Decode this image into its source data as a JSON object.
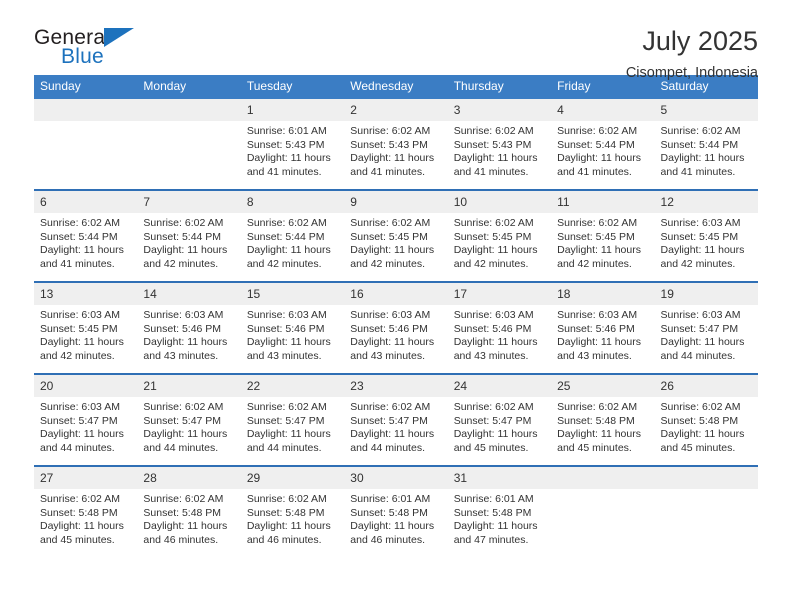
{
  "brand": {
    "name_part1": "General",
    "name_part2": "Blue"
  },
  "header": {
    "title": "July 2025",
    "subtitle": "Cisompet, Indonesia"
  },
  "colors": {
    "header_blue": "#3b7dc4",
    "divider_blue": "#2f6fb5",
    "daynum_band": "#efefef",
    "logo_blue": "#1d72bd",
    "text": "#333333"
  },
  "weekday_headers": [
    "Sunday",
    "Monday",
    "Tuesday",
    "Wednesday",
    "Thursday",
    "Friday",
    "Saturday"
  ],
  "weeks": [
    [
      {
        "day": "",
        "sunrise": "",
        "sunset": "",
        "daylight_line1": "",
        "daylight_line2": ""
      },
      {
        "day": "",
        "sunrise": "",
        "sunset": "",
        "daylight_line1": "",
        "daylight_line2": ""
      },
      {
        "day": "1",
        "sunrise": "Sunrise: 6:01 AM",
        "sunset": "Sunset: 5:43 PM",
        "daylight_line1": "Daylight: 11 hours",
        "daylight_line2": "and 41 minutes."
      },
      {
        "day": "2",
        "sunrise": "Sunrise: 6:02 AM",
        "sunset": "Sunset: 5:43 PM",
        "daylight_line1": "Daylight: 11 hours",
        "daylight_line2": "and 41 minutes."
      },
      {
        "day": "3",
        "sunrise": "Sunrise: 6:02 AM",
        "sunset": "Sunset: 5:43 PM",
        "daylight_line1": "Daylight: 11 hours",
        "daylight_line2": "and 41 minutes."
      },
      {
        "day": "4",
        "sunrise": "Sunrise: 6:02 AM",
        "sunset": "Sunset: 5:44 PM",
        "daylight_line1": "Daylight: 11 hours",
        "daylight_line2": "and 41 minutes."
      },
      {
        "day": "5",
        "sunrise": "Sunrise: 6:02 AM",
        "sunset": "Sunset: 5:44 PM",
        "daylight_line1": "Daylight: 11 hours",
        "daylight_line2": "and 41 minutes."
      }
    ],
    [
      {
        "day": "6",
        "sunrise": "Sunrise: 6:02 AM",
        "sunset": "Sunset: 5:44 PM",
        "daylight_line1": "Daylight: 11 hours",
        "daylight_line2": "and 41 minutes."
      },
      {
        "day": "7",
        "sunrise": "Sunrise: 6:02 AM",
        "sunset": "Sunset: 5:44 PM",
        "daylight_line1": "Daylight: 11 hours",
        "daylight_line2": "and 42 minutes."
      },
      {
        "day": "8",
        "sunrise": "Sunrise: 6:02 AM",
        "sunset": "Sunset: 5:44 PM",
        "daylight_line1": "Daylight: 11 hours",
        "daylight_line2": "and 42 minutes."
      },
      {
        "day": "9",
        "sunrise": "Sunrise: 6:02 AM",
        "sunset": "Sunset: 5:45 PM",
        "daylight_line1": "Daylight: 11 hours",
        "daylight_line2": "and 42 minutes."
      },
      {
        "day": "10",
        "sunrise": "Sunrise: 6:02 AM",
        "sunset": "Sunset: 5:45 PM",
        "daylight_line1": "Daylight: 11 hours",
        "daylight_line2": "and 42 minutes."
      },
      {
        "day": "11",
        "sunrise": "Sunrise: 6:02 AM",
        "sunset": "Sunset: 5:45 PM",
        "daylight_line1": "Daylight: 11 hours",
        "daylight_line2": "and 42 minutes."
      },
      {
        "day": "12",
        "sunrise": "Sunrise: 6:03 AM",
        "sunset": "Sunset: 5:45 PM",
        "daylight_line1": "Daylight: 11 hours",
        "daylight_line2": "and 42 minutes."
      }
    ],
    [
      {
        "day": "13",
        "sunrise": "Sunrise: 6:03 AM",
        "sunset": "Sunset: 5:45 PM",
        "daylight_line1": "Daylight: 11 hours",
        "daylight_line2": "and 42 minutes."
      },
      {
        "day": "14",
        "sunrise": "Sunrise: 6:03 AM",
        "sunset": "Sunset: 5:46 PM",
        "daylight_line1": "Daylight: 11 hours",
        "daylight_line2": "and 43 minutes."
      },
      {
        "day": "15",
        "sunrise": "Sunrise: 6:03 AM",
        "sunset": "Sunset: 5:46 PM",
        "daylight_line1": "Daylight: 11 hours",
        "daylight_line2": "and 43 minutes."
      },
      {
        "day": "16",
        "sunrise": "Sunrise: 6:03 AM",
        "sunset": "Sunset: 5:46 PM",
        "daylight_line1": "Daylight: 11 hours",
        "daylight_line2": "and 43 minutes."
      },
      {
        "day": "17",
        "sunrise": "Sunrise: 6:03 AM",
        "sunset": "Sunset: 5:46 PM",
        "daylight_line1": "Daylight: 11 hours",
        "daylight_line2": "and 43 minutes."
      },
      {
        "day": "18",
        "sunrise": "Sunrise: 6:03 AM",
        "sunset": "Sunset: 5:46 PM",
        "daylight_line1": "Daylight: 11 hours",
        "daylight_line2": "and 43 minutes."
      },
      {
        "day": "19",
        "sunrise": "Sunrise: 6:03 AM",
        "sunset": "Sunset: 5:47 PM",
        "daylight_line1": "Daylight: 11 hours",
        "daylight_line2": "and 44 minutes."
      }
    ],
    [
      {
        "day": "20",
        "sunrise": "Sunrise: 6:03 AM",
        "sunset": "Sunset: 5:47 PM",
        "daylight_line1": "Daylight: 11 hours",
        "daylight_line2": "and 44 minutes."
      },
      {
        "day": "21",
        "sunrise": "Sunrise: 6:02 AM",
        "sunset": "Sunset: 5:47 PM",
        "daylight_line1": "Daylight: 11 hours",
        "daylight_line2": "and 44 minutes."
      },
      {
        "day": "22",
        "sunrise": "Sunrise: 6:02 AM",
        "sunset": "Sunset: 5:47 PM",
        "daylight_line1": "Daylight: 11 hours",
        "daylight_line2": "and 44 minutes."
      },
      {
        "day": "23",
        "sunrise": "Sunrise: 6:02 AM",
        "sunset": "Sunset: 5:47 PM",
        "daylight_line1": "Daylight: 11 hours",
        "daylight_line2": "and 44 minutes."
      },
      {
        "day": "24",
        "sunrise": "Sunrise: 6:02 AM",
        "sunset": "Sunset: 5:47 PM",
        "daylight_line1": "Daylight: 11 hours",
        "daylight_line2": "and 45 minutes."
      },
      {
        "day": "25",
        "sunrise": "Sunrise: 6:02 AM",
        "sunset": "Sunset: 5:48 PM",
        "daylight_line1": "Daylight: 11 hours",
        "daylight_line2": "and 45 minutes."
      },
      {
        "day": "26",
        "sunrise": "Sunrise: 6:02 AM",
        "sunset": "Sunset: 5:48 PM",
        "daylight_line1": "Daylight: 11 hours",
        "daylight_line2": "and 45 minutes."
      }
    ],
    [
      {
        "day": "27",
        "sunrise": "Sunrise: 6:02 AM",
        "sunset": "Sunset: 5:48 PM",
        "daylight_line1": "Daylight: 11 hours",
        "daylight_line2": "and 45 minutes."
      },
      {
        "day": "28",
        "sunrise": "Sunrise: 6:02 AM",
        "sunset": "Sunset: 5:48 PM",
        "daylight_line1": "Daylight: 11 hours",
        "daylight_line2": "and 46 minutes."
      },
      {
        "day": "29",
        "sunrise": "Sunrise: 6:02 AM",
        "sunset": "Sunset: 5:48 PM",
        "daylight_line1": "Daylight: 11 hours",
        "daylight_line2": "and 46 minutes."
      },
      {
        "day": "30",
        "sunrise": "Sunrise: 6:01 AM",
        "sunset": "Sunset: 5:48 PM",
        "daylight_line1": "Daylight: 11 hours",
        "daylight_line2": "and 46 minutes."
      },
      {
        "day": "31",
        "sunrise": "Sunrise: 6:01 AM",
        "sunset": "Sunset: 5:48 PM",
        "daylight_line1": "Daylight: 11 hours",
        "daylight_line2": "and 47 minutes."
      },
      {
        "day": "",
        "sunrise": "",
        "sunset": "",
        "daylight_line1": "",
        "daylight_line2": ""
      },
      {
        "day": "",
        "sunrise": "",
        "sunset": "",
        "daylight_line1": "",
        "daylight_line2": ""
      }
    ]
  ]
}
